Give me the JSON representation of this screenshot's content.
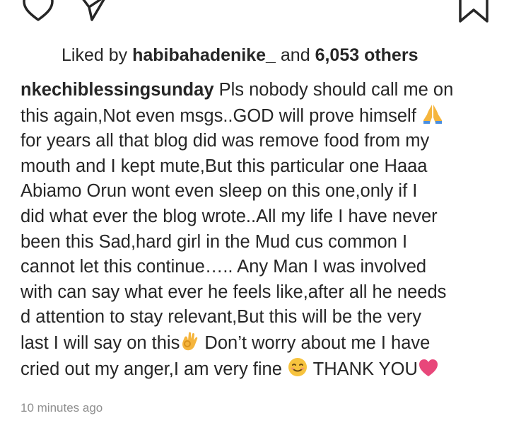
{
  "post": {
    "likes": {
      "prefix": "Liked by",
      "user": "habibahadenike_",
      "connector": "and",
      "count": "6,053 others"
    },
    "caption": {
      "username": "nkechiblessingsunday",
      "line1_text": " Pls nobody should call me on",
      "line2_text": "this again,Not even msgs..GOD will prove himself ",
      "line3_text": "for years all that blog did was remove food from my",
      "line4_text": "mouth and I kept mute,But this particular one Haaa",
      "line5_text": "Abiamo Orun  wont  even sleep on this one,only if I",
      "line6_text": "did what ever the blog wrote..All my life I have never",
      "line7_text": "been this Sad,hard girl in the Mud cus common I",
      "line8_text": "cannot let this continue….. Any Man I was involved",
      "line9_text": "with can say what ever he feels like,after all he needs",
      "line10_text": "d attention to stay relevant,But this will be the very",
      "line11_text": "last I will say on this",
      "line11_text_after": " Don’t worry about me I have",
      "line12_text": "cried out my anger,I am very fine ",
      "line12_text_after": " THANK YOU"
    },
    "timestamp": "10 minutes ago"
  },
  "icons": {
    "like": "heart-icon",
    "share": "paper-plane-icon",
    "save": "bookmark-icon",
    "emoji_pray": "folded-hands-emoji",
    "emoji_ok": "ok-hand-emoji",
    "emoji_smile": "smiling-face-emoji",
    "emoji_heart": "pink-heart-emoji"
  },
  "colors": {
    "text": "#262626",
    "muted": "#8e8e8e",
    "heart": "#e8477a"
  }
}
